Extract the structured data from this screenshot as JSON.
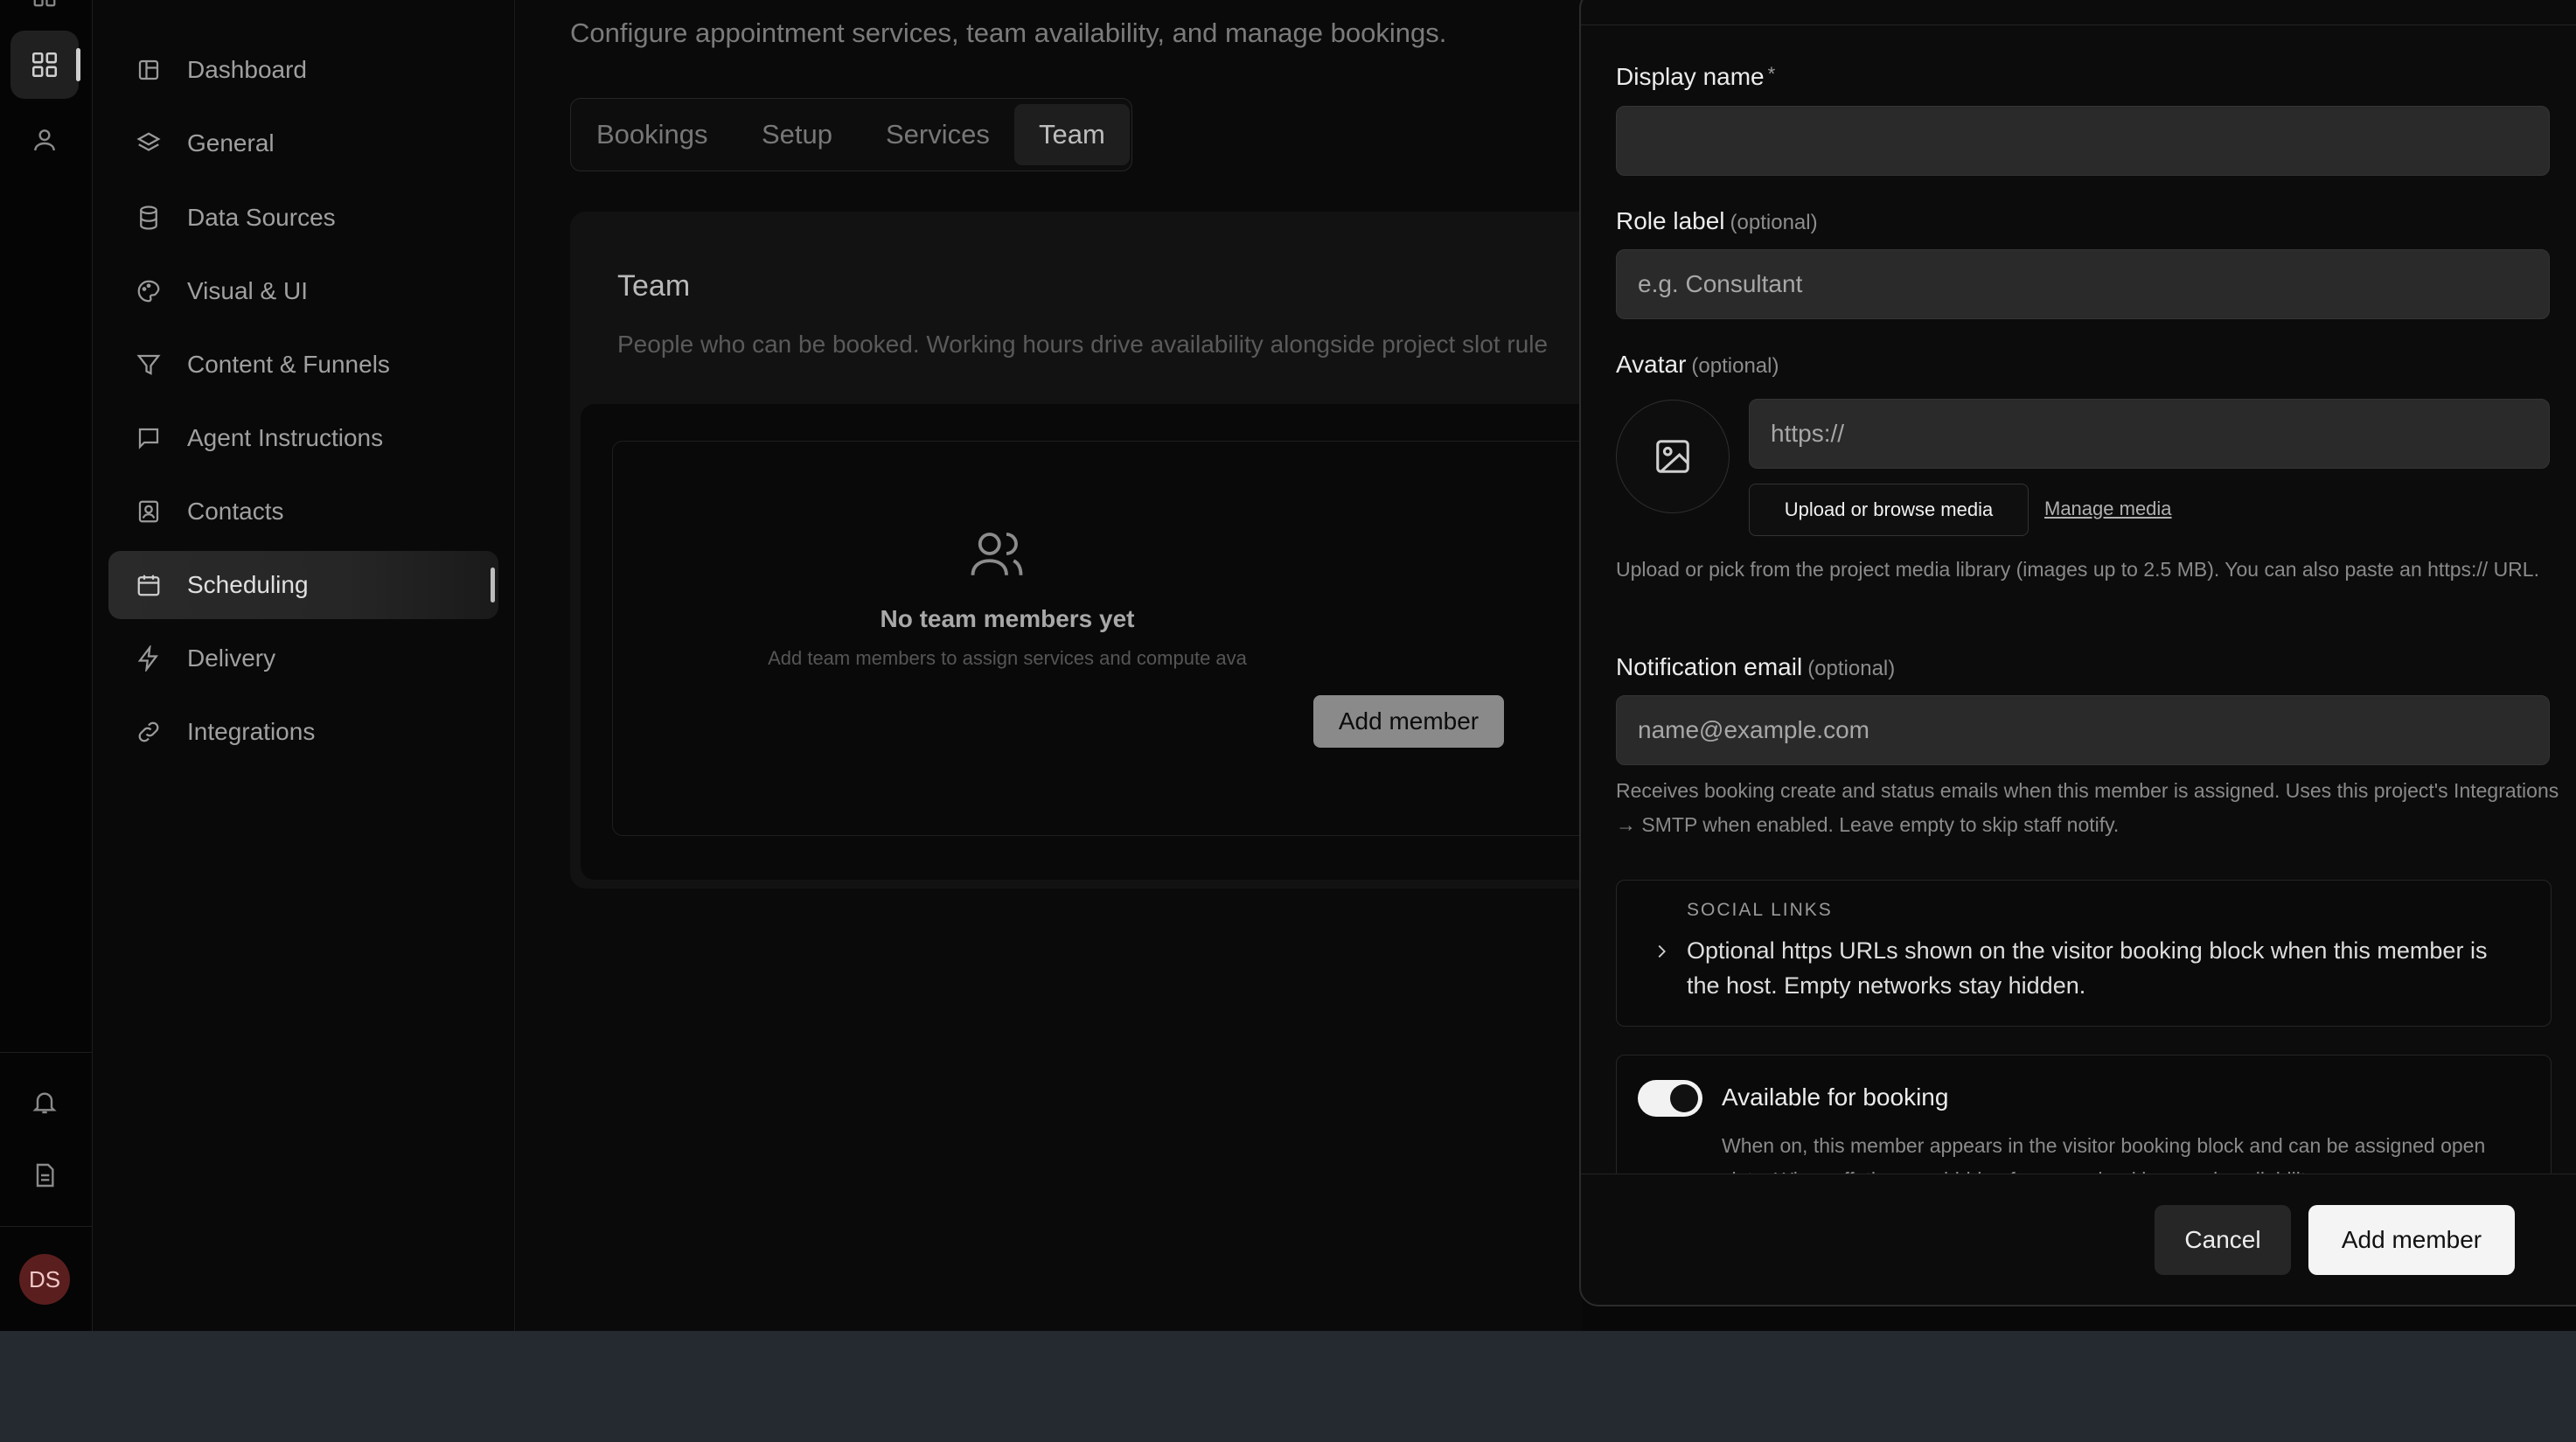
{
  "rail": {
    "avatar_initials": "DS"
  },
  "sidebar": {
    "items": [
      {
        "label": "Dashboard",
        "icon": "dashboard-icon"
      },
      {
        "label": "General",
        "icon": "layers-icon"
      },
      {
        "label": "Data Sources",
        "icon": "database-icon"
      },
      {
        "label": "Visual & UI",
        "icon": "palette-icon"
      },
      {
        "label": "Content & Funnels",
        "icon": "funnel-icon"
      },
      {
        "label": "Agent Instructions",
        "icon": "message-icon"
      },
      {
        "label": "Contacts",
        "icon": "contact-icon"
      },
      {
        "label": "Scheduling",
        "icon": "calendar-icon",
        "active": true
      },
      {
        "label": "Delivery",
        "icon": "bolt-icon"
      },
      {
        "label": "Integrations",
        "icon": "link-icon"
      }
    ]
  },
  "main": {
    "subtitle": "Configure appointment services, team availability, and manage bookings.",
    "tabs": [
      {
        "label": "Bookings"
      },
      {
        "label": "Setup"
      },
      {
        "label": "Services"
      },
      {
        "label": "Team",
        "active": true
      }
    ],
    "team_card": {
      "title": "Team",
      "description": "People who can be booked. Working hours drive availability alongside project slot rule",
      "empty_title": "No team members yet",
      "empty_description": "Add team members to assign services and compute ava",
      "add_button": "Add member"
    }
  },
  "sheet": {
    "display_name": {
      "label": "Display name",
      "required_mark": "*",
      "value": ""
    },
    "role_label": {
      "label": "Role label",
      "optional": "(optional)",
      "placeholder": "e.g. Consultant"
    },
    "avatar": {
      "label": "Avatar",
      "optional": "(optional)",
      "url_placeholder": "https://",
      "upload_button": "Upload or browse media",
      "manage_link": "Manage media",
      "help": "Upload or pick from the project media library (images up to 2.5 MB). You can also paste an https:// URL."
    },
    "notification_email": {
      "label": "Notification email",
      "optional": "(optional)",
      "placeholder": "name@example.com",
      "help": "Receives booking create and status emails when this member is assigned. Uses this project's Integrations → SMTP when enabled. Leave empty to skip staff notify."
    },
    "social_links": {
      "kicker": "SOCIAL LINKS",
      "text": "Optional https URLs shown on the visitor booking block when this member is the host. Empty networks stay hidden."
    },
    "availability": {
      "title": "Available for booking",
      "enabled": true,
      "description": "When on, this member appears in the visitor booking block and can be assigned open slots. When off, they are hidden from new bookings and availability."
    },
    "footer": {
      "cancel": "Cancel",
      "submit": "Add member"
    }
  }
}
